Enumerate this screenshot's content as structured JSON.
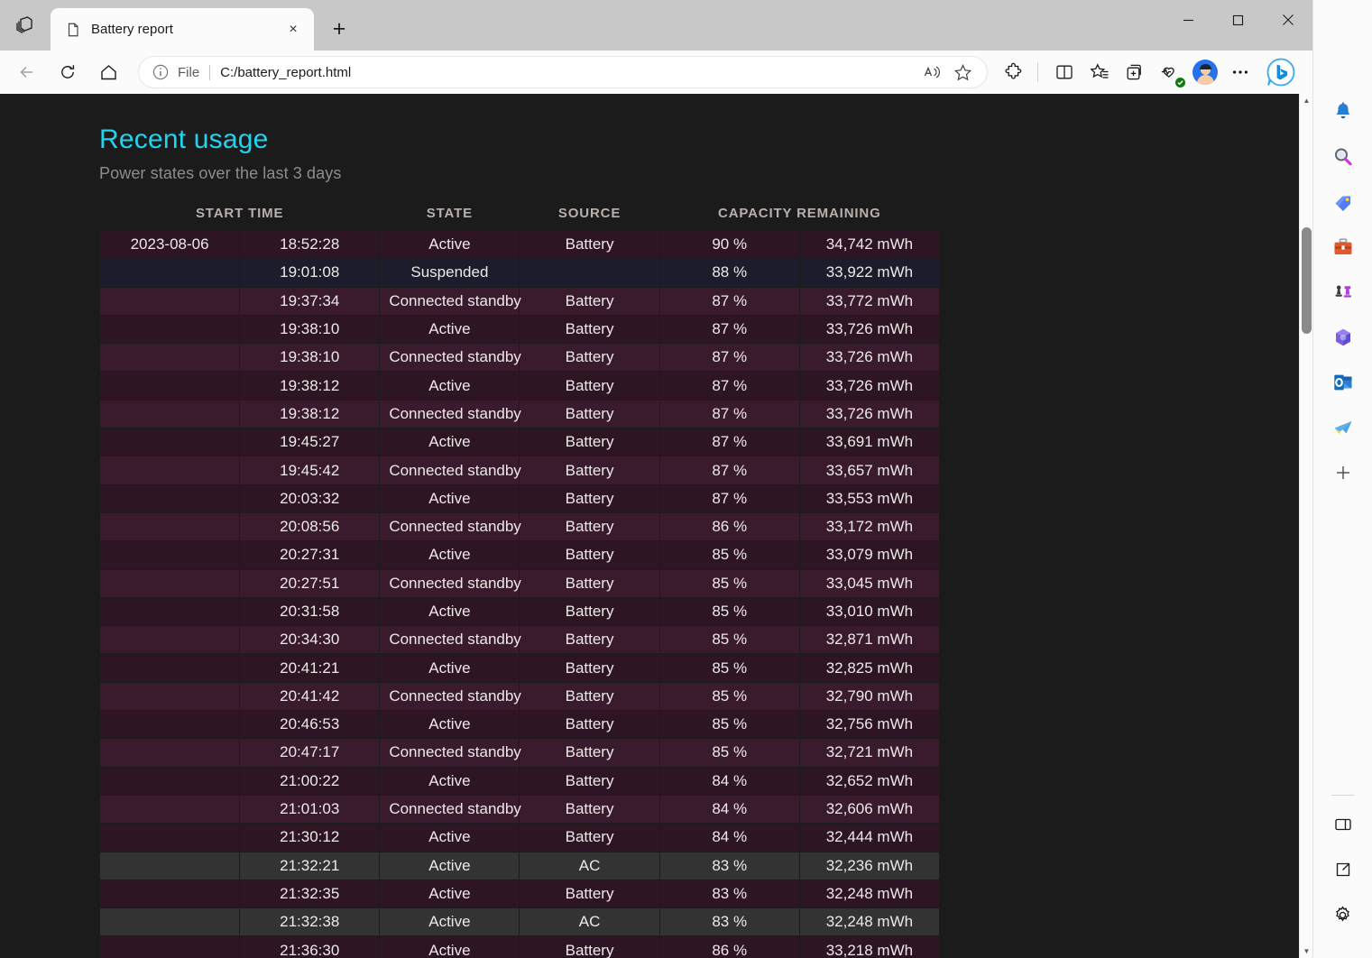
{
  "window": {
    "minimize_label": "Minimize",
    "maximize_label": "Maximize",
    "close_label": "Close"
  },
  "tab": {
    "title": "Battery report",
    "close_label": "×",
    "newtab_label": "+"
  },
  "omnibox": {
    "scheme_label": "File",
    "url": "C:/battery_report.html"
  },
  "page": {
    "heading": "Recent usage",
    "subheading": "Power states over the last 3 days",
    "accent_color": "#22d3ee",
    "background_color": "#1b1b1b"
  },
  "table": {
    "columns": [
      "START TIME",
      "STATE",
      "SOURCE",
      "CAPACITY REMAINING"
    ],
    "rows": [
      {
        "date": "2023-08-06",
        "time": "18:52:28",
        "state": "Active",
        "source": "Battery",
        "pct": "90 %",
        "cap": "34,742 mWh",
        "kind": "battery"
      },
      {
        "date": "",
        "time": "19:01:08",
        "state": "Suspended",
        "source": "",
        "pct": "88 %",
        "cap": "33,922 mWh",
        "kind": "suspended"
      },
      {
        "date": "",
        "time": "19:37:34",
        "state": "Connected standby",
        "source": "Battery",
        "pct": "87 %",
        "cap": "33,772 mWh",
        "kind": "battery-alt"
      },
      {
        "date": "",
        "time": "19:38:10",
        "state": "Active",
        "source": "Battery",
        "pct": "87 %",
        "cap": "33,726 mWh",
        "kind": "battery"
      },
      {
        "date": "",
        "time": "19:38:10",
        "state": "Connected standby",
        "source": "Battery",
        "pct": "87 %",
        "cap": "33,726 mWh",
        "kind": "battery-alt"
      },
      {
        "date": "",
        "time": "19:38:12",
        "state": "Active",
        "source": "Battery",
        "pct": "87 %",
        "cap": "33,726 mWh",
        "kind": "battery"
      },
      {
        "date": "",
        "time": "19:38:12",
        "state": "Connected standby",
        "source": "Battery",
        "pct": "87 %",
        "cap": "33,726 mWh",
        "kind": "battery-alt"
      },
      {
        "date": "",
        "time": "19:45:27",
        "state": "Active",
        "source": "Battery",
        "pct": "87 %",
        "cap": "33,691 mWh",
        "kind": "battery"
      },
      {
        "date": "",
        "time": "19:45:42",
        "state": "Connected standby",
        "source": "Battery",
        "pct": "87 %",
        "cap": "33,657 mWh",
        "kind": "battery-alt"
      },
      {
        "date": "",
        "time": "20:03:32",
        "state": "Active",
        "source": "Battery",
        "pct": "87 %",
        "cap": "33,553 mWh",
        "kind": "battery"
      },
      {
        "date": "",
        "time": "20:08:56",
        "state": "Connected standby",
        "source": "Battery",
        "pct": "86 %",
        "cap": "33,172 mWh",
        "kind": "battery-alt"
      },
      {
        "date": "",
        "time": "20:27:31",
        "state": "Active",
        "source": "Battery",
        "pct": "85 %",
        "cap": "33,079 mWh",
        "kind": "battery"
      },
      {
        "date": "",
        "time": "20:27:51",
        "state": "Connected standby",
        "source": "Battery",
        "pct": "85 %",
        "cap": "33,045 mWh",
        "kind": "battery-alt"
      },
      {
        "date": "",
        "time": "20:31:58",
        "state": "Active",
        "source": "Battery",
        "pct": "85 %",
        "cap": "33,010 mWh",
        "kind": "battery"
      },
      {
        "date": "",
        "time": "20:34:30",
        "state": "Connected standby",
        "source": "Battery",
        "pct": "85 %",
        "cap": "32,871 mWh",
        "kind": "battery-alt"
      },
      {
        "date": "",
        "time": "20:41:21",
        "state": "Active",
        "source": "Battery",
        "pct": "85 %",
        "cap": "32,825 mWh",
        "kind": "battery"
      },
      {
        "date": "",
        "time": "20:41:42",
        "state": "Connected standby",
        "source": "Battery",
        "pct": "85 %",
        "cap": "32,790 mWh",
        "kind": "battery-alt"
      },
      {
        "date": "",
        "time": "20:46:53",
        "state": "Active",
        "source": "Battery",
        "pct": "85 %",
        "cap": "32,756 mWh",
        "kind": "battery"
      },
      {
        "date": "",
        "time": "20:47:17",
        "state": "Connected standby",
        "source": "Battery",
        "pct": "85 %",
        "cap": "32,721 mWh",
        "kind": "battery-alt"
      },
      {
        "date": "",
        "time": "21:00:22",
        "state": "Active",
        "source": "Battery",
        "pct": "84 %",
        "cap": "32,652 mWh",
        "kind": "battery"
      },
      {
        "date": "",
        "time": "21:01:03",
        "state": "Connected standby",
        "source": "Battery",
        "pct": "84 %",
        "cap": "32,606 mWh",
        "kind": "battery-alt"
      },
      {
        "date": "",
        "time": "21:30:12",
        "state": "Active",
        "source": "Battery",
        "pct": "84 %",
        "cap": "32,444 mWh",
        "kind": "battery"
      },
      {
        "date": "",
        "time": "21:32:21",
        "state": "Active",
        "source": "AC",
        "pct": "83 %",
        "cap": "32,236 mWh",
        "kind": "ac-alt"
      },
      {
        "date": "",
        "time": "21:32:35",
        "state": "Active",
        "source": "Battery",
        "pct": "83 %",
        "cap": "32,248 mWh",
        "kind": "battery"
      },
      {
        "date": "",
        "time": "21:32:38",
        "state": "Active",
        "source": "AC",
        "pct": "83 %",
        "cap": "32,248 mWh",
        "kind": "ac-alt"
      },
      {
        "date": "",
        "time": "21:36:30",
        "state": "Active",
        "source": "Battery",
        "pct": "86 %",
        "cap": "33,218 mWh",
        "kind": "battery"
      }
    ]
  },
  "sidebar": {
    "items": [
      {
        "name": "notifications-icon",
        "label": "Notifications"
      },
      {
        "name": "search-icon",
        "label": "Search"
      },
      {
        "name": "shopping-tag-icon",
        "label": "Shopping"
      },
      {
        "name": "tools-icon",
        "label": "Tools"
      },
      {
        "name": "games-icon",
        "label": "Games"
      },
      {
        "name": "microsoft365-icon",
        "label": "Microsoft 365"
      },
      {
        "name": "outlook-icon",
        "label": "Outlook"
      },
      {
        "name": "telegram-icon",
        "label": "Telegram"
      },
      {
        "name": "add-icon",
        "label": "Add"
      }
    ],
    "bottom_items": [
      {
        "name": "split-pane-icon",
        "label": "Customize"
      },
      {
        "name": "open-external-icon",
        "label": "Open in new window"
      },
      {
        "name": "settings-gear-icon",
        "label": "Settings"
      }
    ]
  }
}
